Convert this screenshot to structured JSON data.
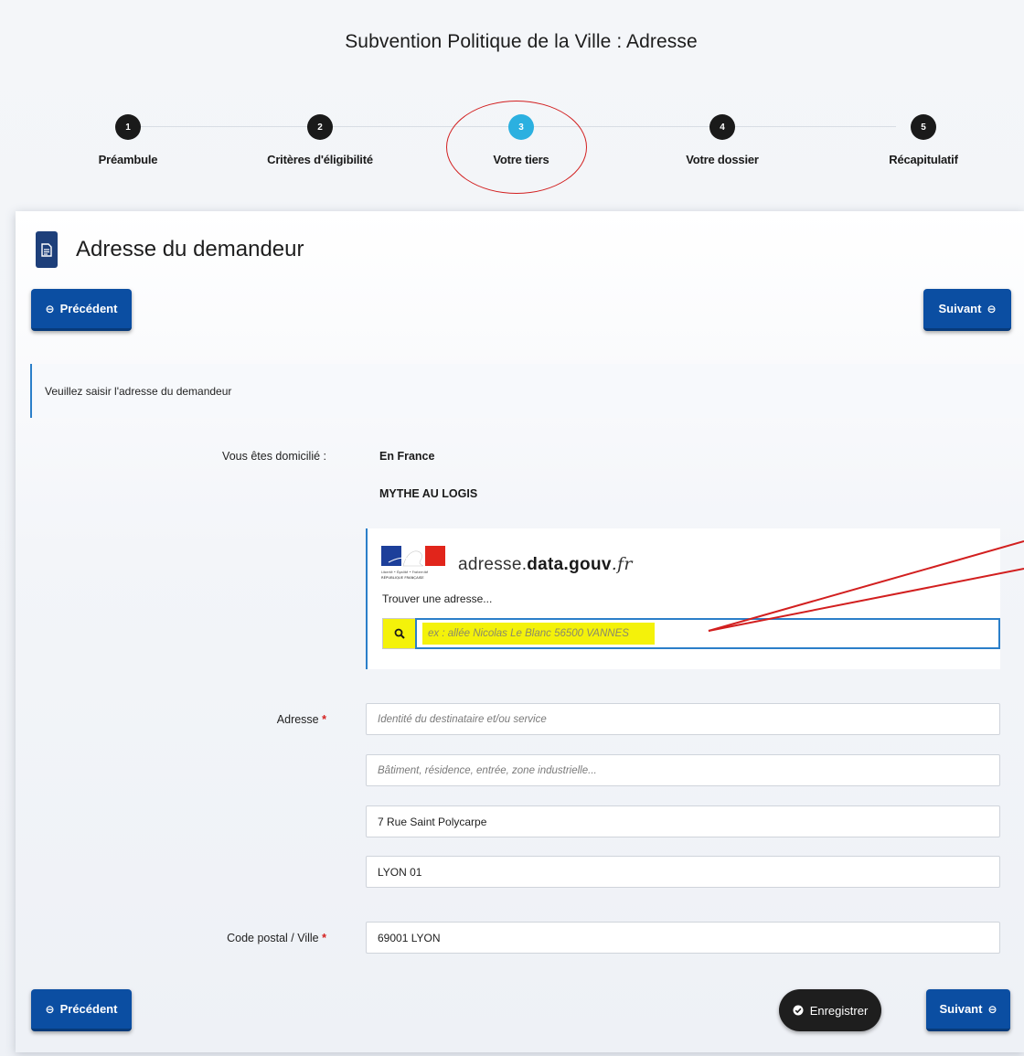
{
  "page": {
    "title": "Subvention Politique de la Ville : Adresse"
  },
  "stepper": {
    "steps": [
      {
        "number": "1",
        "label": "Préambule"
      },
      {
        "number": "2",
        "label": "Critères d'éligibilité"
      },
      {
        "number": "3",
        "label": "Votre tiers"
      },
      {
        "number": "4",
        "label": "Votre dossier"
      },
      {
        "number": "5",
        "label": "Récapitulatif"
      }
    ],
    "active_step": 3
  },
  "card": {
    "title": "Adresse du demandeur",
    "prev_label": "Précédent",
    "next_label": "Suivant",
    "save_label": "Enregistrer",
    "info": "Veuillez saisir l'adresse du demandeur"
  },
  "domicile": {
    "label": "Vous êtes domicilié :",
    "value": "En France",
    "name": "MYTHE AU LOGIS"
  },
  "api": {
    "title_prefix": "adresse.",
    "title_bold": "data.gouv",
    "title_suffix": ".fr",
    "find_label": "Trouver une adresse...",
    "search_placeholder": "ex : allée Nicolas Le Blanc 56500 VANNES",
    "logo_text_top": "Liberté • Égalité • Fraternité",
    "logo_text_bottom": "RÉPUBLIQUE FRANÇAISE"
  },
  "address": {
    "label": "Adresse",
    "required_mark": "*",
    "line1_placeholder": "Identité du destinataire et/ou service",
    "line2_placeholder": "Bâtiment, résidence, entrée, zone industrielle...",
    "line3_value": "7 Rue Saint Polycarpe",
    "line4_value": "LYON 01"
  },
  "postal": {
    "label": "Code postal / Ville",
    "required_mark": "*",
    "value": "69001 LYON"
  },
  "colors": {
    "primary_button": "#0b4ea2",
    "active_step": "#2bb0e0",
    "annotation_red": "#d21f1f",
    "highlight_yellow": "#f4f20a"
  }
}
